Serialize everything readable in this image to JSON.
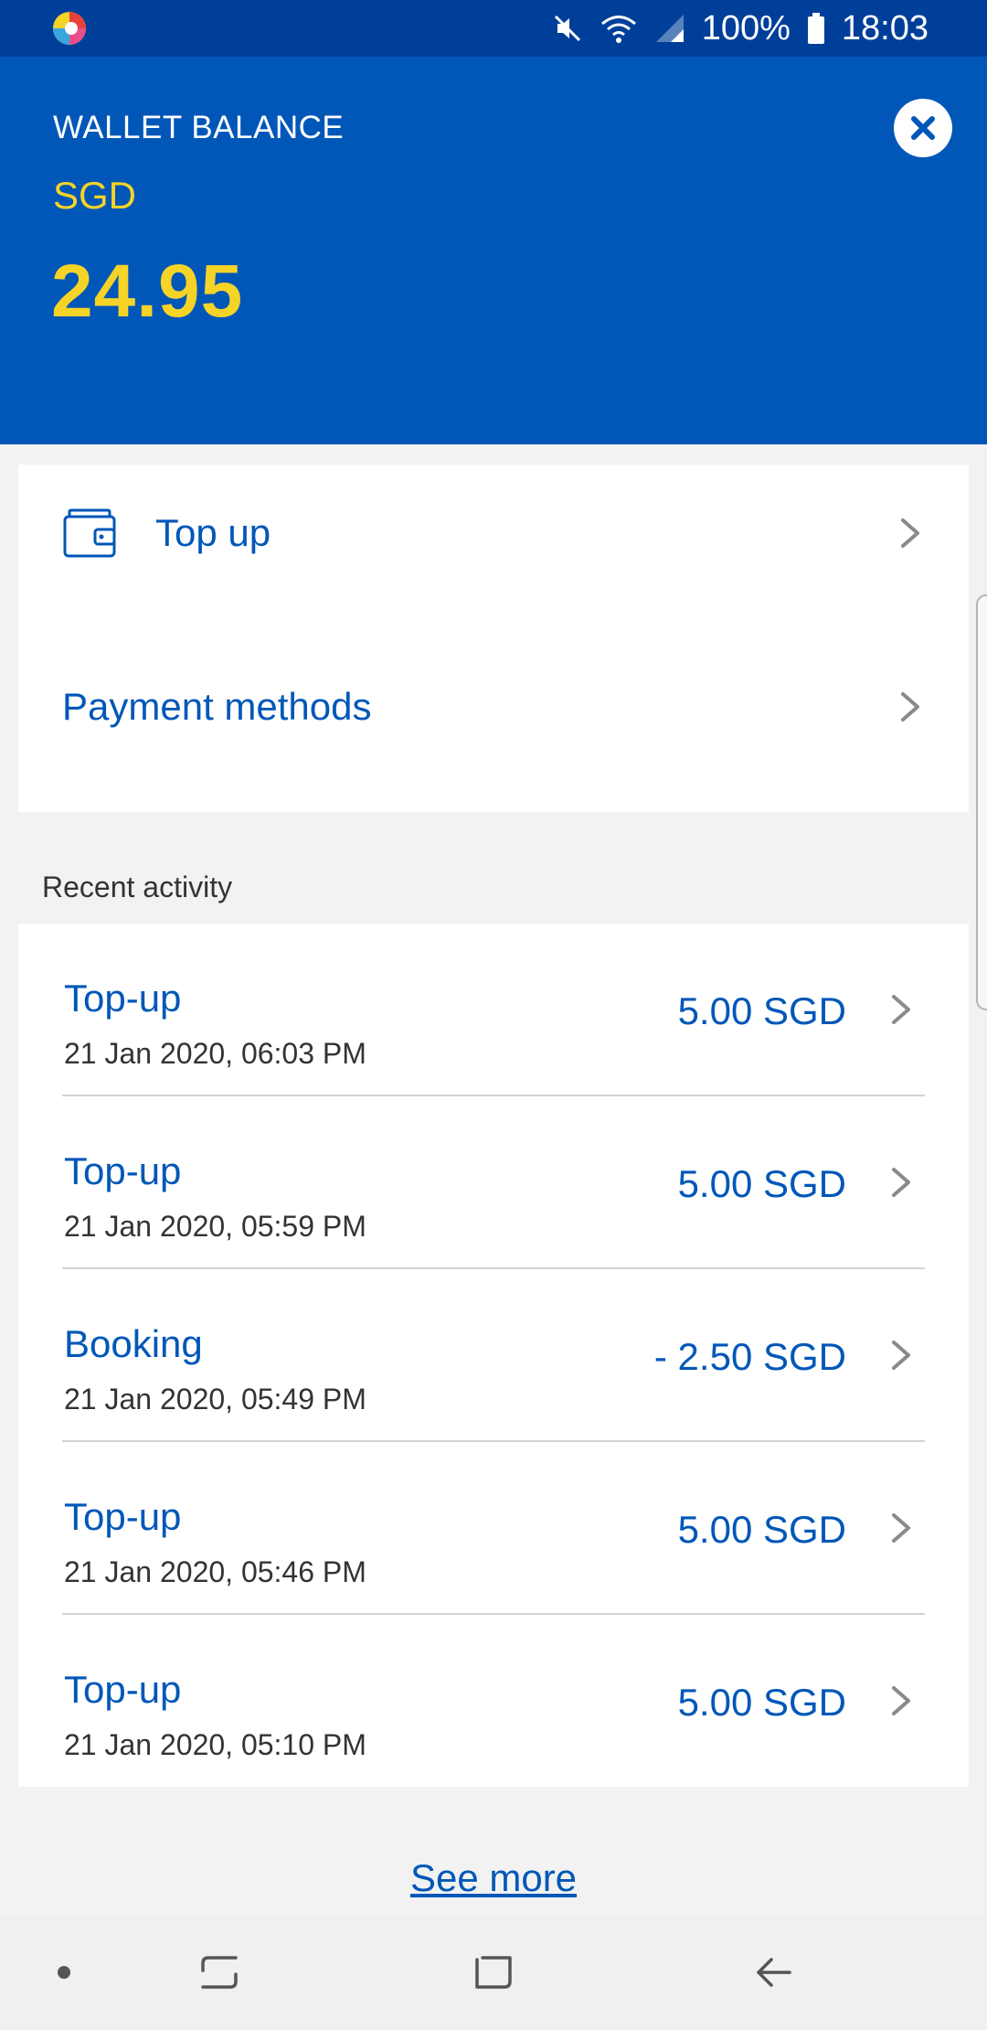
{
  "status_bar": {
    "battery_percent": "100%",
    "time": "18:03",
    "icons": [
      "app-logo-icon",
      "mute-icon",
      "wifi-icon",
      "signal-icon",
      "battery-icon"
    ]
  },
  "wallet": {
    "label": "WALLET BALANCE",
    "currency": "SGD",
    "amount": "24.95"
  },
  "actions": [
    {
      "label": "Top up",
      "icon": "wallet-icon"
    },
    {
      "label": "Payment methods"
    }
  ],
  "recent_activity": {
    "title": "Recent activity",
    "items": [
      {
        "type": "Top-up",
        "date": "21 Jan 2020, 06:03 PM",
        "amount": "5.00 SGD"
      },
      {
        "type": "Top-up",
        "date": "21 Jan 2020, 05:59 PM",
        "amount": "5.00 SGD"
      },
      {
        "type": "Booking",
        "date": "21 Jan 2020, 05:49 PM",
        "amount": "- 2.50 SGD"
      },
      {
        "type": "Top-up",
        "date": "21 Jan 2020, 05:46 PM",
        "amount": "5.00 SGD"
      },
      {
        "type": "Top-up",
        "date": "21 Jan 2020, 05:10 PM",
        "amount": "5.00 SGD"
      }
    ],
    "see_more": "See more"
  },
  "colors": {
    "status_bar": "#003f99",
    "header": "#0057b8",
    "accent_yellow": "#f5d327",
    "link_blue": "#0057b8",
    "background": "#f2f2f2"
  },
  "nav_bar": {
    "icons": [
      "dot-icon",
      "recents-icon",
      "home-icon",
      "back-icon"
    ]
  }
}
